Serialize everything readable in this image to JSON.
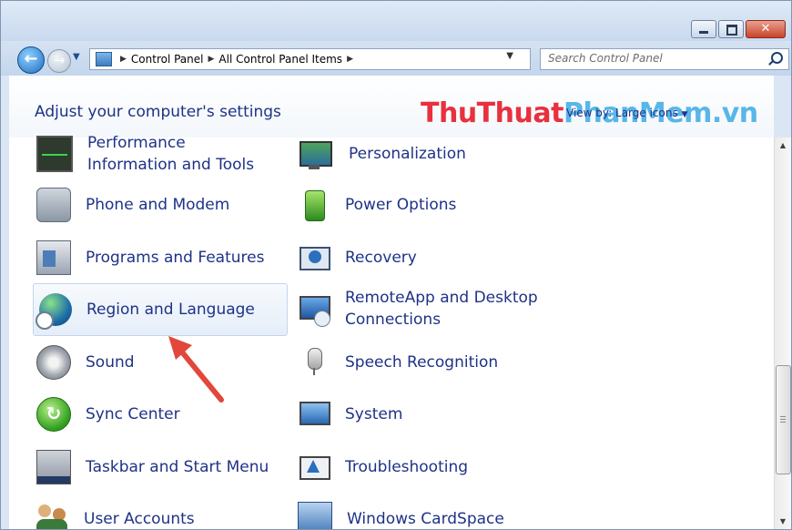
{
  "window": {
    "controls": {
      "minimize": "minimize",
      "maximize": "maximize",
      "close": "✕"
    }
  },
  "nav": {
    "breadcrumb": [
      "Control Panel",
      "All Control Panel Items"
    ],
    "search_placeholder": "Search Control Panel"
  },
  "header": {
    "title": "Adjust your computer's settings",
    "view_by_label": "View by:",
    "view_by_value": "Large icons"
  },
  "watermark": {
    "part1": "ThuThuat",
    "part2": "PhanMem.vn"
  },
  "items": {
    "left": [
      {
        "label": "Performance Information and Tools",
        "icon": "performance-icon"
      },
      {
        "label": "Phone and Modem",
        "icon": "phone-modem-icon"
      },
      {
        "label": "Programs and Features",
        "icon": "programs-icon"
      },
      {
        "label": "Region and Language",
        "icon": "globe-clock-icon",
        "selected": true
      },
      {
        "label": "Sound",
        "icon": "speaker-icon"
      },
      {
        "label": "Sync Center",
        "icon": "sync-icon"
      },
      {
        "label": "Taskbar and Start Menu",
        "icon": "taskbar-icon"
      },
      {
        "label": "User Accounts",
        "icon": "users-icon"
      }
    ],
    "right": [
      {
        "label": "Personalization",
        "icon": "personalization-icon"
      },
      {
        "label": "Power Options",
        "icon": "battery-icon"
      },
      {
        "label": "Recovery",
        "icon": "recovery-icon"
      },
      {
        "label": "RemoteApp and Desktop Connections",
        "icon": "remote-desktop-icon"
      },
      {
        "label": "Speech Recognition",
        "icon": "microphone-icon"
      },
      {
        "label": "System",
        "icon": "system-icon"
      },
      {
        "label": "Troubleshooting",
        "icon": "troubleshoot-icon"
      },
      {
        "label": "Windows CardSpace",
        "icon": "cardspace-icon"
      }
    ]
  },
  "colors": {
    "link": "#1e3287",
    "watermark_red": "#e8303e",
    "watermark_blue": "#58b6e8",
    "arrow": "#e2473c"
  }
}
